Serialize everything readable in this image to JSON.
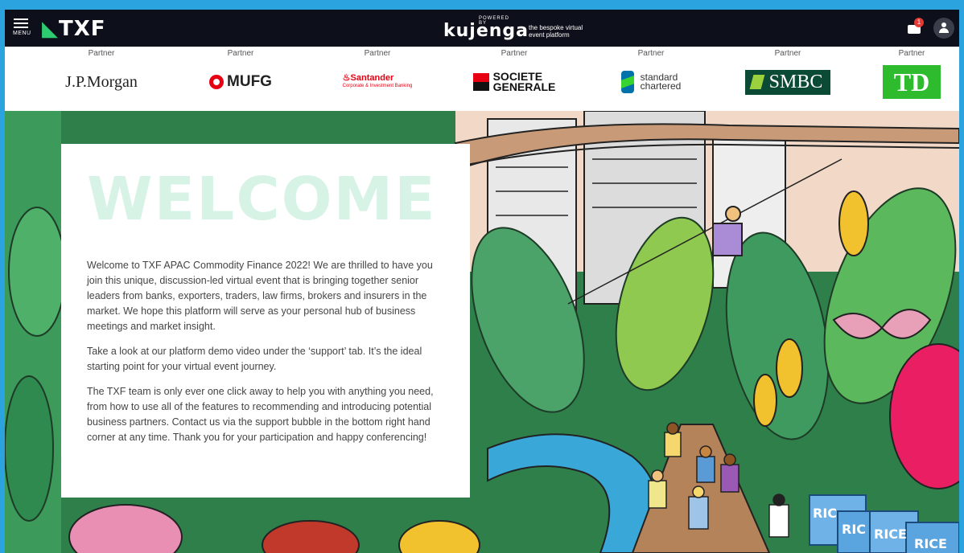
{
  "header": {
    "menu_label": "MENU",
    "brand": "TXF",
    "kujenga_powered": "POWERED BY",
    "kujenga_word": "kujenga",
    "kujenga_tagline": "the bespoke virtual event platform",
    "notification_count": "1"
  },
  "partners": [
    {
      "label": "Partner",
      "name": "J.P.Morgan"
    },
    {
      "label": "Partner",
      "name": "MUFG"
    },
    {
      "label": "Partner",
      "name": "Santander",
      "sub": "Corporate & Investment Banking"
    },
    {
      "label": "Partner",
      "name_line1": "SOCIETE",
      "name_line2": "GENERALE"
    },
    {
      "label": "Partner",
      "name_line1": "standard",
      "name_line2": "chartered"
    },
    {
      "label": "Partner",
      "name": "SMBC"
    },
    {
      "label": "Partner",
      "name": "TD"
    }
  ],
  "welcome": {
    "title": "WELCOME",
    "p1": "Welcome to TXF APAC Commodity Finance 2022! We are thrilled to have you join this unique, discussion-led virtual event that is bringing together senior leaders from banks, exporters, traders, law firms, brokers and insurers in the market. We hope this platform will serve as your personal hub of business meetings and market insight.",
    "p2": "Take a look at our platform demo video under the ‘support’ tab. It’s the ideal starting point for your virtual event journey.",
    "p3": "The TXF team is only ever one click away to help you with anything you need, from how to use all of the features to recommending and introducing potential business partners. Contact us via the support bubble in the bottom right hand corner at any time. Thank you for your participation and happy conferencing!"
  },
  "scene": {
    "rice_labels": [
      "RIC",
      "RIC",
      "RICE",
      "RICE"
    ]
  },
  "colors": {
    "frame": "#2aa3df",
    "topbar": "#0d0f1a",
    "welcome_title": "#d6f3e6",
    "brand_green": "#2ecc71"
  }
}
